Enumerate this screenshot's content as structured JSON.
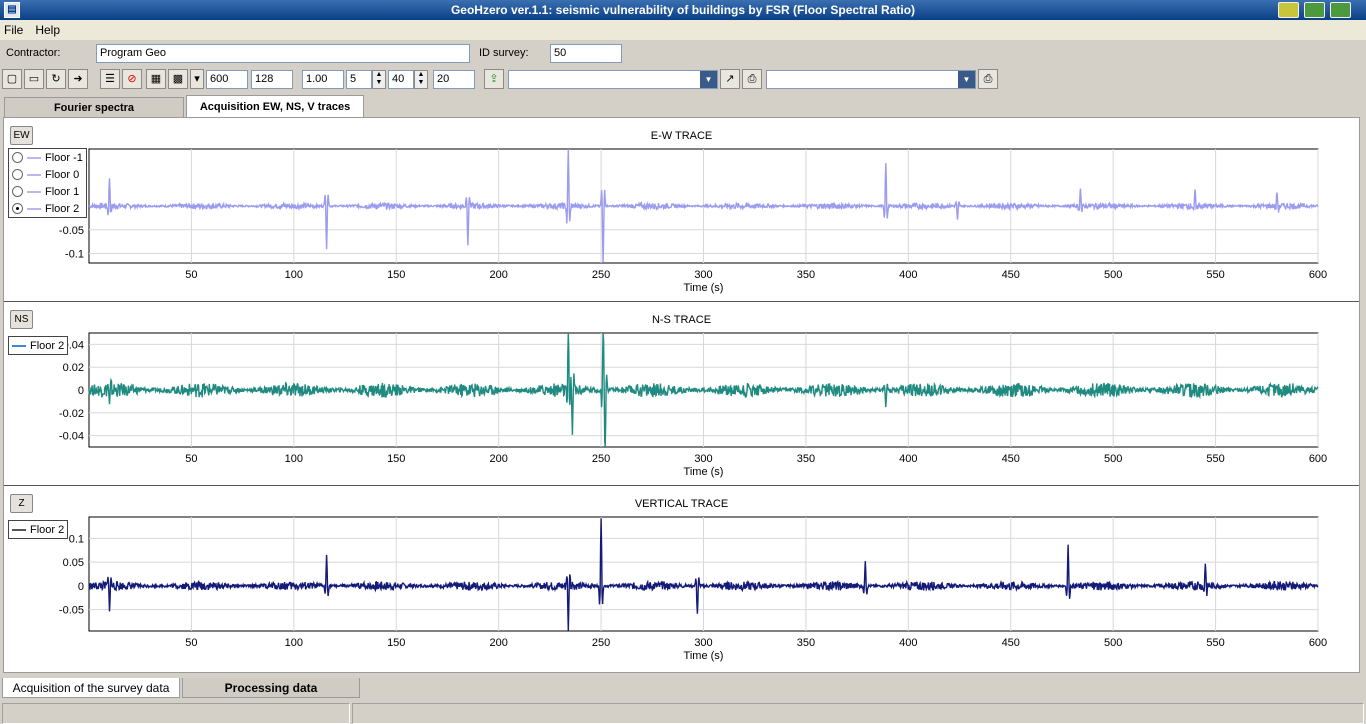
{
  "window": {
    "title": "GeoHzero ver.1.1: seismic vulnerability of buildings by FSR  (Floor Spectral Ratio)"
  },
  "menu": [
    "File",
    "Help"
  ],
  "form": {
    "contractor_label": "Contractor:",
    "contractor_value": "Program Geo",
    "id_label": "ID survey:",
    "id_value": "50"
  },
  "toolbar": {
    "f1": "600",
    "f2": "128",
    "f3": "1.00",
    "f4": "5",
    "f5": "40",
    "f6": "20"
  },
  "tabs": [
    "Fourier spectra",
    "Acquisition EW, NS, V traces"
  ],
  "panels": [
    {
      "channel": "EW",
      "title": "E-W TRACE",
      "xlabel": "Time (s)",
      "color": "#9b9bef",
      "yticks": [
        "-0.05",
        "-0.1"
      ],
      "legend": [
        {
          "label": "Floor -1",
          "selected": false
        },
        {
          "label": "Floor 0",
          "selected": false
        },
        {
          "label": "Floor 1",
          "selected": false
        },
        {
          "label": "Floor 2",
          "selected": true
        }
      ]
    },
    {
      "channel": "NS",
      "title": "N-S TRACE",
      "xlabel": "Time (s)",
      "color": "#1f8a80",
      "yticks": [
        "0.04",
        "0.02",
        "0",
        "-0.02",
        "-0.04"
      ],
      "legend": [
        {
          "label": "Floor 2"
        }
      ]
    },
    {
      "channel": "Z",
      "title": "VERTICAL TRACE",
      "xlabel": "Time (s)",
      "color": "#141a78",
      "yticks": [
        "0.1",
        "0.05",
        "0",
        "-0.05"
      ],
      "legend": [
        {
          "label": "Floor 2"
        }
      ]
    }
  ],
  "chart_data": [
    {
      "type": "line",
      "title": "E-W TRACE",
      "xlabel": "Time (s)",
      "xlim": [
        0,
        600
      ],
      "xticks": [
        50,
        100,
        150,
        200,
        250,
        300,
        350,
        400,
        450,
        500,
        550,
        600
      ],
      "ylim": [
        -0.12,
        0.12
      ],
      "series": [
        {
          "name": "Floor 2",
          "spikes": [
            [
              10,
              0.06
            ],
            [
              116,
              -0.09
            ],
            [
              185,
              -0.08
            ],
            [
              234,
              0.12
            ],
            [
              251,
              -0.12
            ],
            [
              389,
              0.09
            ],
            [
              424,
              -0.03
            ],
            [
              484,
              0.04
            ],
            [
              540,
              0.03
            ],
            [
              580,
              0.03
            ]
          ],
          "noise": 0.004
        }
      ]
    },
    {
      "type": "line",
      "title": "N-S TRACE",
      "xlabel": "Time (s)",
      "xlim": [
        0,
        600
      ],
      "xticks": [
        50,
        100,
        150,
        200,
        250,
        300,
        350,
        400,
        450,
        500,
        550,
        600
      ],
      "ylim": [
        -0.05,
        0.05
      ],
      "series": [
        {
          "name": "Floor 2",
          "spikes": [
            [
              10,
              -0.015
            ],
            [
              234,
              0.05
            ],
            [
              236,
              -0.04
            ],
            [
              251,
              0.05
            ],
            [
              252,
              -0.05
            ],
            [
              389,
              -0.015
            ]
          ],
          "noise": 0.004
        }
      ]
    },
    {
      "type": "line",
      "title": "VERTICAL TRACE",
      "xlabel": "Time (s)",
      "xlim": [
        0,
        600
      ],
      "xticks": [
        50,
        100,
        150,
        200,
        250,
        300,
        350,
        400,
        450,
        500,
        550,
        600
      ],
      "ylim": [
        -0.095,
        0.145
      ],
      "series": [
        {
          "name": "Floor 2",
          "spikes": [
            [
              10,
              -0.045
            ],
            [
              116,
              0.065
            ],
            [
              234,
              -0.09
            ],
            [
              250,
              0.145
            ],
            [
              297,
              -0.06
            ],
            [
              379,
              0.055
            ],
            [
              478,
              0.085
            ],
            [
              545,
              0.05
            ]
          ],
          "noise": 0.006
        }
      ]
    }
  ],
  "bottom_tabs": [
    "Acquisition of the survey data",
    "Processing data"
  ]
}
